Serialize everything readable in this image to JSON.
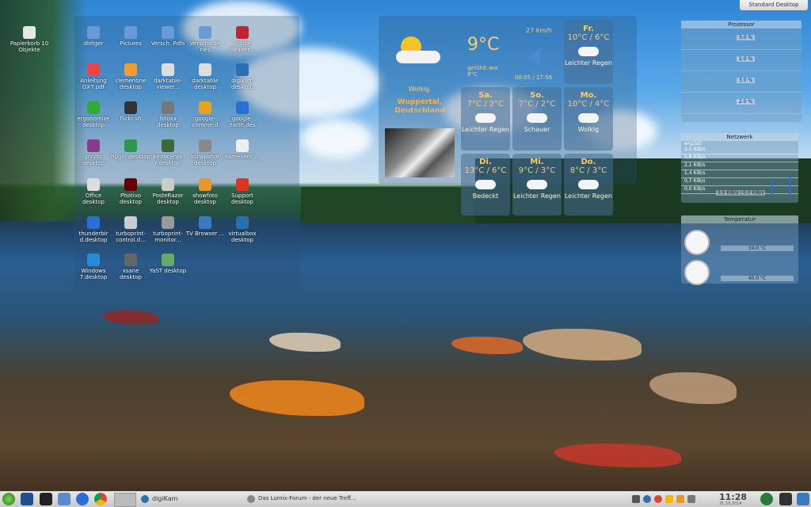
{
  "desktop_button": "Standard Desktop",
  "desktop_icons": [
    {
      "label": "Papierkorb\n10 Objekte",
      "color": "#ddd"
    },
    {
      "label": "dietger",
      "color": "#6a9ad6"
    },
    {
      "label": "Pictures",
      "color": "#6a9ad6"
    },
    {
      "label": "Versch. Pdfs",
      "color": "#6a9ad6"
    },
    {
      "label": "Verschiede nes",
      "color": "#6a9ad6"
    },
    {
      "label": "Adobe Reader...",
      "color": "#c0262d"
    },
    {
      "label": "Anleitung GX7.pdf",
      "color": "#e44"
    },
    {
      "label": "clementine desktop",
      "color": "#f39c30"
    },
    {
      "label": "darktable-viewer...",
      "color": "#ddd"
    },
    {
      "label": "darktable desktop",
      "color": "#ddd"
    },
    {
      "label": "digikam desktop",
      "color": "#2b6fb0"
    },
    {
      "label": "ergonomize desktop",
      "color": "#3a3"
    },
    {
      "label": "flickr.sh",
      "color": "#333"
    },
    {
      "label": "fotoxx desktop",
      "color": "#777"
    },
    {
      "label": "google-chrome.d",
      "color": "#e8a21c"
    },
    {
      "label": "google-earth.des",
      "color": "#2a6fd6"
    },
    {
      "label": "grsync desktop",
      "color": "#8a3a8a"
    },
    {
      "label": "hugin desktop",
      "color": "#2a9a4a"
    },
    {
      "label": "kinfocente r.desktop",
      "color": "#3a6a3a"
    },
    {
      "label": "ksnapshot desktop",
      "color": "#888"
    },
    {
      "label": "namelienc ...",
      "color": "#eee"
    },
    {
      "label": "Office desktop",
      "color": "#ddd"
    },
    {
      "label": "Photivo desktop",
      "color": "#600"
    },
    {
      "label": "PosteRazor desktop",
      "color": "#ccc"
    },
    {
      "label": "showfoto desktop",
      "color": "#e6962a"
    },
    {
      "label": "Support desktop",
      "color": "#d9361c"
    },
    {
      "label": "thunderbir d.desktop",
      "color": "#2a6fd6"
    },
    {
      "label": "turboprint-control.d...",
      "color": "#ccc"
    },
    {
      "label": "turboprint-monitor...",
      "color": "#999"
    },
    {
      "label": "TV Browser ...",
      "color": "#3a7abf"
    },
    {
      "label": "virtualbox desktop",
      "color": "#2a6fb0"
    },
    {
      "label": "Windows 7.desktop",
      "color": "#2a8ad6"
    },
    {
      "label": "xsane desktop",
      "color": "#666"
    },
    {
      "label": "YaST desktop",
      "color": "#6a6"
    }
  ],
  "weather": {
    "current_temp": "9°C",
    "wind": "27 km/h",
    "feels": "gefühlt wie 6°C",
    "time": "08:05 / 17:56",
    "condition": "Wolkig",
    "location": "Wuppertal, Deutschland",
    "forecast": [
      {
        "day": "Fr.",
        "temp": "10°C / 6°C",
        "cond": "Leichter Regen"
      },
      {
        "day": "Sa.",
        "temp": "7°C / 2°C",
        "cond": "Leichter Regen"
      },
      {
        "day": "So.",
        "temp": "7°C / 2°C",
        "cond": "Schauer"
      },
      {
        "day": "Mo.",
        "temp": "10°C / 4°C",
        "cond": "Wolkig"
      },
      {
        "day": "Di.",
        "temp": "13°C / 6°C",
        "cond": "Bedeckt"
      },
      {
        "day": "Mi.",
        "temp": "9°C / 3°C",
        "cond": "Leichter Regen"
      },
      {
        "day": "Do.",
        "temp": "8°C / 3°C",
        "cond": "Leichter Regen"
      }
    ]
  },
  "processor": {
    "title": "Prozessor",
    "cores": [
      "3.0 %",
      "2.0 %",
      "3.0 %",
      "2.0 %"
    ]
  },
  "network": {
    "title": "Netzwerk",
    "iface": "enp3s0",
    "scale": [
      "3,5 KiB/s",
      "2,8 KiB/s",
      "2,1 KiB/s",
      "1,4 KiB/s",
      "0,7 KiB/s",
      "0,0 KiB/s"
    ],
    "reading": "3.0 KiB/s | 0.0 KiB/s"
  },
  "temperature": {
    "title": "Temperatur",
    "values": [
      "34.0 °C",
      "40.0 °C"
    ]
  },
  "taskbar": {
    "window1": "digiKam",
    "window2": "Das Lumix-Forum - der neue Treff...",
    "clock": "11:28",
    "date": "31.10.2014"
  }
}
